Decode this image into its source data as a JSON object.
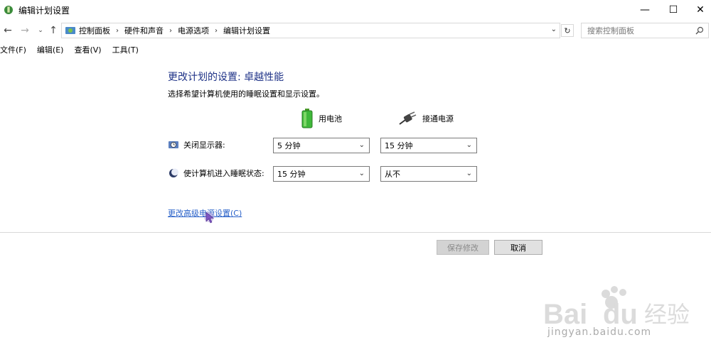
{
  "window": {
    "title": "编辑计划设置",
    "min_glyph": "—",
    "max_glyph": "☐",
    "close_glyph": "✕"
  },
  "nav": {
    "back_glyph": "←",
    "forward_glyph": "→",
    "recent_glyph": "⌄",
    "up_glyph": "↑",
    "breadcrumb": [
      "控制面板",
      "硬件和声音",
      "电源选项",
      "编辑计划设置"
    ],
    "sep_glyph": "›",
    "dropdown_glyph": "⌄",
    "refresh_glyph": "↻",
    "search_placeholder": "搜索控制面板"
  },
  "menu": [
    "文件(F)",
    "编辑(E)",
    "查看(V)",
    "工具(T)"
  ],
  "content": {
    "heading": "更改计划的设置: 卓越性能",
    "subheading": "选择希望计算机使用的睡眠设置和显示设置。",
    "col_battery": "用电池",
    "col_plugged": "接通电源",
    "rows": [
      {
        "label": "关闭显示器:",
        "battery": "5 分钟",
        "plugged": "15 分钟"
      },
      {
        "label": "使计算机进入睡眠状态:",
        "battery": "15 分钟",
        "plugged": "从不"
      }
    ],
    "chevron_glyph": "⌄",
    "advanced_link": "更改高级电源设置(C)"
  },
  "buttons": {
    "save": "保存修改",
    "cancel": "取消"
  },
  "watermark": {
    "text": "jingyan.baidu.com"
  },
  "colors": {
    "heading": "#1e3287",
    "link": "#2a62c9"
  }
}
